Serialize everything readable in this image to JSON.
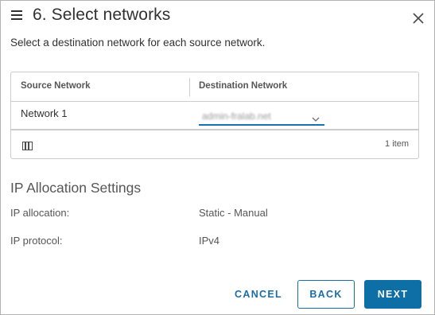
{
  "dialog": {
    "title": "6. Select networks",
    "subtitle": "Select a destination network for each source network.",
    "menu_icon": "hamburger-menu-icon",
    "close_icon": "close-icon"
  },
  "network_grid": {
    "columns": [
      "Source Network",
      "Destination Network"
    ],
    "rows": [
      {
        "source": "Network 1",
        "destination": "admin-fralab.net"
      }
    ],
    "footer": {
      "column_toggle_icon": "column-toggle-icon",
      "item_count": "1 item"
    }
  },
  "ip_allocation": {
    "title": "IP Allocation Settings",
    "properties": [
      {
        "label": "IP allocation:",
        "value": "Static - Manual"
      },
      {
        "label": "IP protocol:",
        "value": "IPv4"
      }
    ]
  },
  "buttons": {
    "cancel": "CANCEL",
    "back": "BACK",
    "next": "NEXT"
  },
  "colors": {
    "primary": "#0e6fa6",
    "link": "#1b6da8",
    "border": "#cccccc"
  }
}
